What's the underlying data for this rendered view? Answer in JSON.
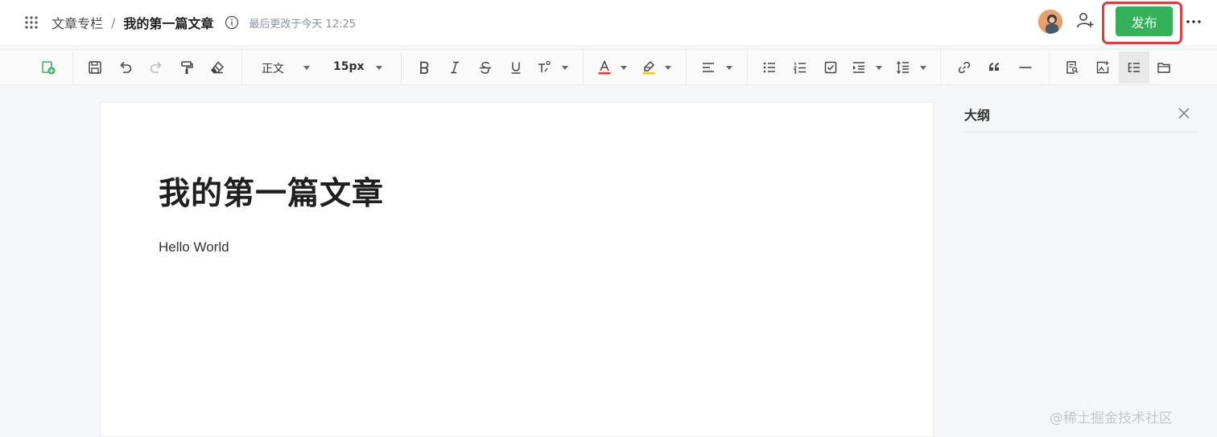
{
  "header": {
    "breadcrumb_parent": "文章专栏",
    "breadcrumb_separator": "/",
    "breadcrumb_current": "我的第一篇文章",
    "last_modified": "最后更改于今天 12:25",
    "publish_label": "发布"
  },
  "toolbar": {
    "paragraph_style": "正文",
    "font_size": "15px"
  },
  "document": {
    "title": "我的第一篇文章",
    "body": "Hello World"
  },
  "outline": {
    "title": "大纲"
  },
  "watermark": "@稀土掘金技术社区",
  "colors": {
    "publish_green": "#34b25b",
    "highlight_red": "#e23b3b",
    "font_color_underline": "#e53935",
    "highlight_underline": "#f5c518",
    "new_doc_icon_green": "#34b25b"
  },
  "icons": [
    "apps-grid-icon",
    "info-icon",
    "add-user-icon",
    "more-dots-icon",
    "new-document-icon",
    "save-icon",
    "undo-icon",
    "redo-icon",
    "format-painter-icon",
    "eraser-icon",
    "bold-icon",
    "italic-icon",
    "strikethrough-icon",
    "underline-icon",
    "superscript-icon",
    "font-color-icon",
    "highlight-icon",
    "align-left-icon",
    "bullet-list-icon",
    "numbered-list-icon",
    "checklist-icon",
    "indent-icon",
    "line-height-icon",
    "link-icon",
    "quote-icon",
    "horizontal-rule-icon",
    "find-icon",
    "image-icon",
    "outline-toggle-icon",
    "folder-icon",
    "close-icon"
  ]
}
